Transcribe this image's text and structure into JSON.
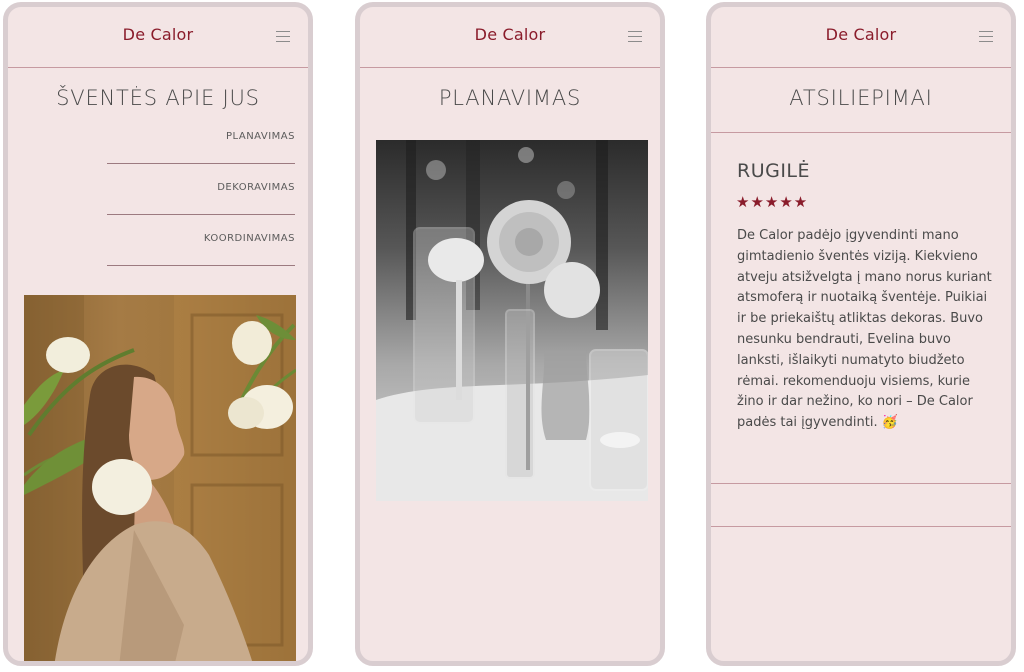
{
  "brand": "De Calor",
  "colors": {
    "accent": "#8a1c2b",
    "background": "#f3e5e5",
    "frame": "#d9cdd0",
    "divider": "#c69aa1"
  },
  "icons": {
    "menu": "hamburger-menu-icon",
    "rating": "star-icon"
  },
  "screen1": {
    "title": "ŠVENTĖS APIE JUS",
    "menu": [
      {
        "label": "PLANAVIMAS"
      },
      {
        "label": "DEKORAVIMAS"
      },
      {
        "label": "KOORDINAVIMAS"
      }
    ]
  },
  "screen2": {
    "title": "PLANAVIMAS"
  },
  "screen3": {
    "title": "ATSILIEPIMAI",
    "reviewer": "RUGILĖ",
    "rating": 5,
    "stars": "★★★★★",
    "review": "De Calor padėjo įgyvendinti mano gimtadienio šventės viziją. Kiekvieno atveju atsižvelgta į mano norus kuriant atsmoferą ir nuotaiką šventėje. Puikiai ir be priekaištų atliktas dekoras. Buvo nesunku bendrauti, Evelina buvo lanksti, išlaikyti numatyto biudžeto rėmai. rekomenduoju visiems, kurie žino ir dar nežino, ko nori – De Calor padės tai įgyvendinti. 🥳"
  }
}
